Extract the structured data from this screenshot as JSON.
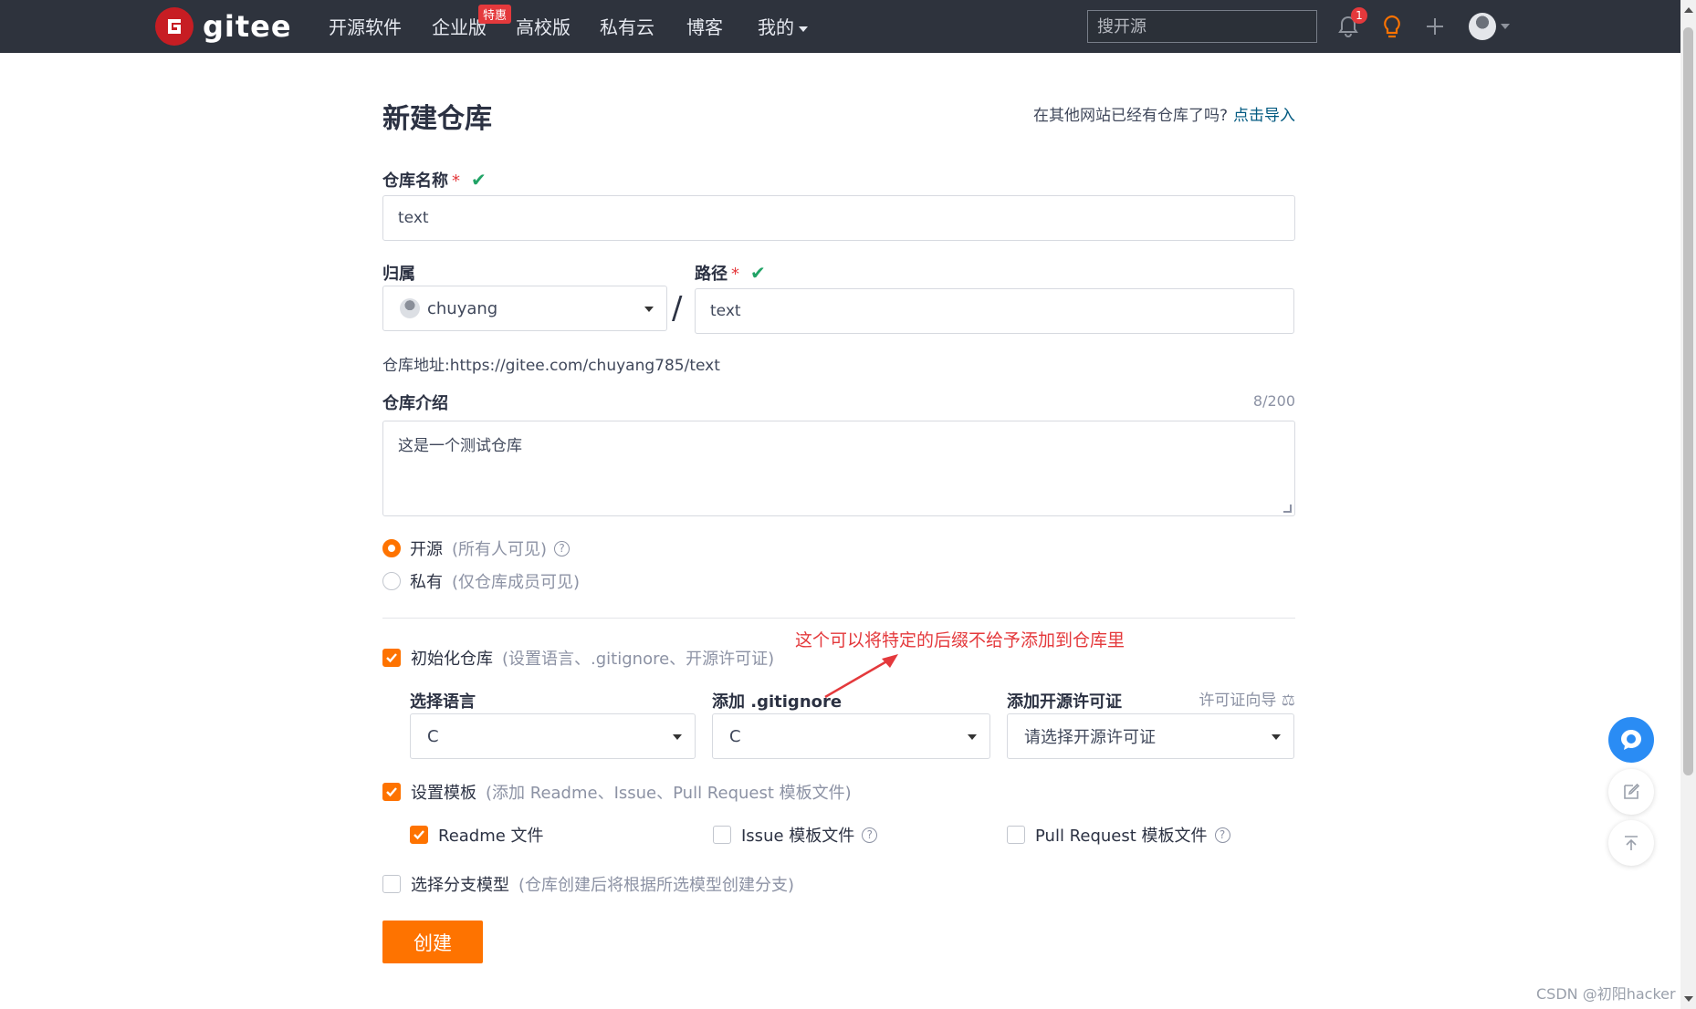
{
  "nav": {
    "logo_text": "gitee",
    "items": [
      "开源软件",
      "企业版",
      "高校版",
      "私有云",
      "博客",
      "我的"
    ],
    "promo_badge": "特惠",
    "search_placeholder": "搜开源",
    "notification_count": "1",
    "icons": [
      "bell-icon",
      "lightbulb-icon",
      "plus-icon",
      "avatar"
    ]
  },
  "form": {
    "title": "新建仓库",
    "import_question": "在其他网站已经有仓库了吗?",
    "import_link": "点击导入",
    "repo_name_label": "仓库名称",
    "required_mark": "*",
    "repo_name_value": "text",
    "owner_label": "归属",
    "owner_value": "chuyang",
    "separator": "/",
    "path_label": "路径",
    "path_value": "text",
    "repo_url_label": "仓库地址:",
    "repo_url_value": "https://gitee.com/chuyang785/text",
    "desc_label": "仓库介绍",
    "desc_counter": "8/200",
    "desc_value": "这是一个测试仓库",
    "visibility": {
      "public_label": "开源",
      "public_hint": "(所有人可见)",
      "private_label": "私有",
      "private_hint": "(仅仓库成员可见)",
      "selected": "public"
    },
    "init_repo": {
      "label": "初始化仓库",
      "hint": "(设置语言、.gitignore、开源许可证)",
      "checked": true
    },
    "annotation": "这个可以将特定的后缀不给予添加到仓库里",
    "language": {
      "label": "选择语言",
      "value": "C"
    },
    "gitignore": {
      "label": "添加 .gitignore",
      "value": "C"
    },
    "license": {
      "label": "添加开源许可证",
      "guide": "许可证向导",
      "placeholder": "请选择开源许可证"
    },
    "template": {
      "label": "设置模板",
      "hint": "(添加 Readme、Issue、Pull Request 模板文件)",
      "checked": true,
      "readme": {
        "label": "Readme 文件",
        "checked": true
      },
      "issue": {
        "label": "Issue 模板文件",
        "checked": false
      },
      "pr": {
        "label": "Pull Request 模板文件",
        "checked": false
      }
    },
    "branch_model": {
      "label": "选择分支模型",
      "hint": "(仓库创建后将根据所选模型创建分支)",
      "checked": false
    },
    "submit_label": "创建"
  },
  "watermark": "CSDN @初阳hacker",
  "colors": {
    "nav_bg": "#2e333d",
    "accent": "#fe7300",
    "link": "#005980",
    "success": "#21a366",
    "danger": "#e4393c",
    "logo": "#c71d23"
  }
}
